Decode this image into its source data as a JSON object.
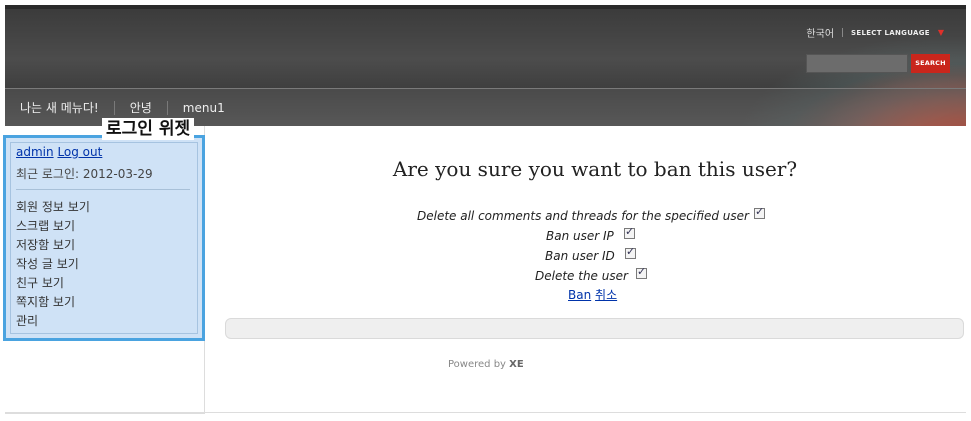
{
  "header": {
    "language_current": "한국어",
    "select_language": "SELECT LANGUAGE",
    "search_button": "SEARCH",
    "search_placeholder": ""
  },
  "nav": {
    "items": [
      "나는 새 메뉴다!",
      "안녕",
      "menu1"
    ]
  },
  "login_widget": {
    "title": "로그인 위젯",
    "username_link": "admin",
    "logout_link": "Log out",
    "last_login": "최근 로그인: 2012-03-29",
    "menu": [
      "회원 정보 보기",
      "스크랩 보기",
      "저장함 보기",
      "작성 글 보기",
      "친구 보기",
      "쪽지함 보기",
      "관리"
    ]
  },
  "ban_form": {
    "title": "Are you sure you want to ban this user?",
    "options": [
      {
        "label": "Delete all comments and threads for the specified user",
        "checked": true
      },
      {
        "label": "Ban user IP",
        "checked": true
      },
      {
        "label": "Ban user ID",
        "checked": true
      },
      {
        "label": "Delete the user",
        "checked": true
      }
    ],
    "ban_link": "Ban",
    "cancel_link": "취소"
  },
  "footer": {
    "powered_by": "Powered by",
    "brand": "XE"
  },
  "colors": {
    "accent_red": "#c9261c",
    "widget_border": "#4aa3e0",
    "widget_bg": "#cfe2f6",
    "link": "#0033aa"
  }
}
